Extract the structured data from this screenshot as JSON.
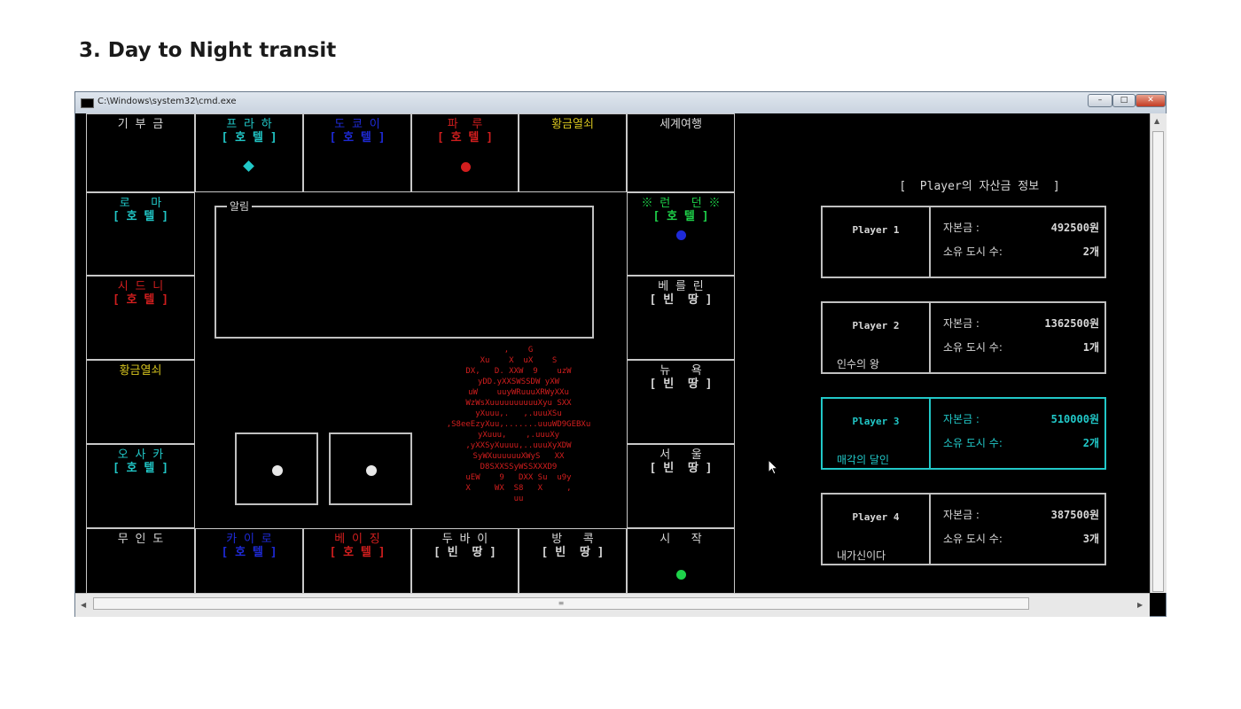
{
  "slide": {
    "title": "3. Day to Night transit"
  },
  "window": {
    "title": "C:\\Windows\\system32\\cmd.exe",
    "buttons": {
      "minimize": "–",
      "maximize": "□",
      "close": "✕"
    }
  },
  "board": {
    "top": [
      {
        "name": "기 부 금",
        "tag": "",
        "name_color": "#d8d8d8"
      },
      {
        "name": "프 라 하",
        "tag": "[ 호 텔 ]",
        "name_color": "#21c8c8",
        "piece": "diamond",
        "piece_color": "#21c8c8"
      },
      {
        "name": "도 쿄 이",
        "tag": "[ 호 텔 ]",
        "name_color": "#1e2ad8"
      },
      {
        "name": "파  루",
        "tag": "[ 호 텔 ]",
        "name_color": "#d21e1e",
        "piece": "dot",
        "piece_color": "#d21e1e"
      },
      {
        "name": "황금열쇠",
        "tag": "",
        "name_color": "#d4c21e"
      },
      {
        "name": "세계여행",
        "tag": "",
        "name_color": "#d8d8d8"
      }
    ],
    "left": [
      {
        "name": "로   마",
        "tag": "[ 호 텔 ]",
        "name_color": "#21c8c8"
      },
      {
        "name": "시 드 니",
        "tag": "[ 호 텔 ]",
        "name_color": "#d21e1e"
      },
      {
        "name": "황금열쇠",
        "tag": "",
        "name_color": "#d4c21e"
      },
      {
        "name": "오 사 카",
        "tag": "[ 호 텔 ]",
        "name_color": "#21c8c8"
      }
    ],
    "right": [
      {
        "name": "※ 런   던 ※",
        "tag": "[ 호 텔 ]",
        "name_color": "#1ed24a",
        "piece": "dot",
        "piece_color": "#1e2ad8"
      },
      {
        "name": "베 를 린",
        "tag": "[ 빈  땅 ]",
        "name_color": "#d8d8d8"
      },
      {
        "name": "뉴   욕",
        "tag": "[ 빈  땅 ]",
        "name_color": "#d8d8d8"
      },
      {
        "name": "서   울",
        "tag": "[ 빈  땅 ]",
        "name_color": "#d8d8d8"
      }
    ],
    "bottom": [
      {
        "name": "무 인 도",
        "tag": "",
        "name_color": "#d8d8d8"
      },
      {
        "name": "카 이 로",
        "tag": "[ 호 텔 ]",
        "name_color": "#1e2ad8"
      },
      {
        "name": "베 이 징",
        "tag": "[ 호 텔 ]",
        "name_color": "#d21e1e"
      },
      {
        "name": "두 바 이",
        "tag": "[ 빈  땅 ]",
        "name_color": "#d8d8d8"
      },
      {
        "name": "방   콕",
        "tag": "[ 빈  땅 ]",
        "name_color": "#d8d8d8"
      },
      {
        "name": "시   작",
        "tag": "",
        "name_color": "#d8d8d8",
        "piece": "dot",
        "piece_color": "#1ed24a"
      }
    ],
    "alert_label": "알림",
    "art_lines": [
      ",    G",
      "Xu    X  uX    S",
      "DX,   D. XXW  9    uzW",
      "yDD.yXXSWSSDW yXW",
      "uW    uuyWRuuuXRWyXXu",
      "WzWsXuuuuuuuuuuXyu SXX",
      "yXuuu,.   ,.uuuXSu",
      ",S8eeEzyXuu,.......uuuWD9GEBXu",
      "yXuuu,    ,.uuuXy",
      ",yXXSyXuuuu,..uuuXyXDW",
      "SyWXuuuuuuXWyS   XX",
      "D8SXXSSyWSSXXXD9",
      "uEW    9   DXX Su  u9y",
      "X     WX  S8   X     ,",
      "uu"
    ]
  },
  "players_panel": {
    "title": "[  Player의 자산금 정보  ]",
    "players": [
      {
        "name": "Player 1",
        "title_text": "",
        "money_label": "자본금 :",
        "money": "492500원",
        "cities_label": "소유 도시 수:",
        "cities": "2개",
        "active": false
      },
      {
        "name": "Player 2",
        "title_text": "인수의 왕",
        "money_label": "자본금 :",
        "money": "1362500원",
        "cities_label": "소유 도시 수:",
        "cities": "1개",
        "active": false
      },
      {
        "name": "Player 3",
        "title_text": "매각의 달인",
        "money_label": "자본금 :",
        "money": "510000원",
        "cities_label": "소유 도시 수:",
        "cities": "2개",
        "active": true
      },
      {
        "name": "Player 4",
        "title_text": "내가신이다",
        "money_label": "자본금 :",
        "money": "387500원",
        "cities_label": "소유 도시 수:",
        "cities": "3개",
        "active": false
      }
    ]
  },
  "colors": {
    "background": "#000000",
    "border": "#c8c8c8",
    "active_player": "#21c8c8"
  },
  "icons": {
    "window_icon": "console-icon",
    "cursor": "arrow-cursor-icon"
  }
}
